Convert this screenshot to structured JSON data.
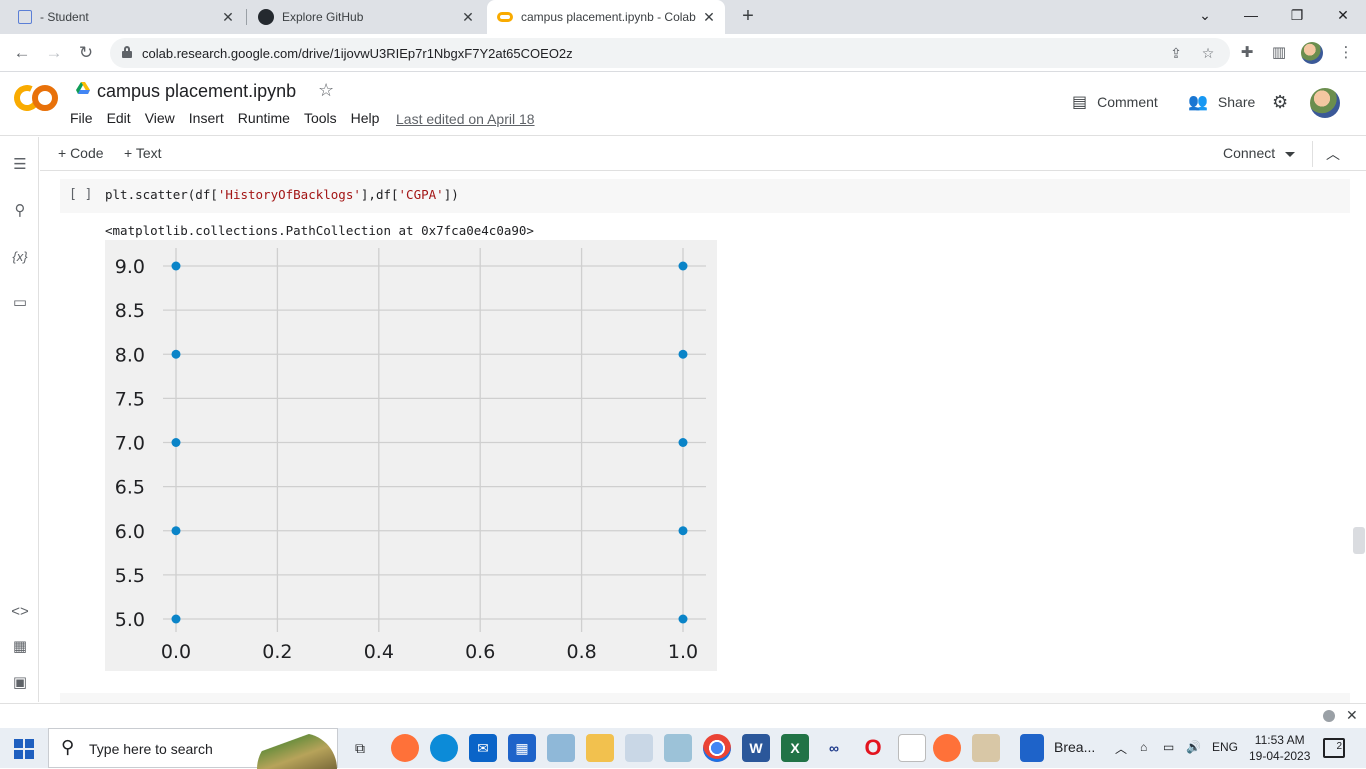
{
  "browser": {
    "tabs": [
      {
        "title": "- Student",
        "icon": "student-favicon"
      },
      {
        "title": "Explore GitHub",
        "icon": "github-favicon"
      },
      {
        "title": "campus placement.ipynb - Colab",
        "icon": "colab-favicon"
      }
    ],
    "new_tab": "+",
    "url": "colab.research.google.com/drive/1ijovwU3RIEp7r1NbgxF7Y2at65COEO2z"
  },
  "colab": {
    "notebook_title": "campus placement.ipynb",
    "menu": [
      "File",
      "Edit",
      "View",
      "Insert",
      "Runtime",
      "Tools",
      "Help"
    ],
    "last_edited": "Last edited on April 18",
    "comment_label": "Comment",
    "share_label": "Share",
    "add_code_label": "+ Code",
    "add_text_label": "+ Text",
    "connect_label": "Connect"
  },
  "cell": {
    "bracket": "[ ]",
    "code_parts": [
      "plt.scatter(df[",
      "'HistoryOfBacklogs'",
      "],df[",
      "'CGPA'",
      "])"
    ],
    "output_text": "<matplotlib.collections.PathCollection at 0x7fca0e4c0a90>"
  },
  "chart_data": {
    "type": "scatter",
    "x": [
      0.0,
      0.0,
      0.0,
      0.0,
      0.0,
      1.0,
      1.0,
      1.0,
      1.0,
      1.0
    ],
    "y": [
      9.0,
      8.0,
      7.0,
      6.0,
      5.0,
      9.0,
      8.0,
      7.0,
      6.0,
      5.0
    ],
    "xlim": [
      -0.14,
      1.05
    ],
    "ylim": [
      4.95,
      9.3
    ],
    "xticks": [
      "0.0",
      "0.2",
      "0.4",
      "0.6",
      "0.8",
      "1.0"
    ],
    "yticks": [
      "5.0",
      "5.5",
      "6.0",
      "6.5",
      "7.0",
      "7.5",
      "8.0",
      "8.5",
      "9.0"
    ],
    "grid": true,
    "point_color": "#0a84c8",
    "background": "#f0f0f0"
  },
  "taskbar": {
    "search_placeholder": "Type here to search",
    "browser_app_label": "Brea...",
    "language": "ENG",
    "time": "11:53 AM",
    "date": "19-04-2023",
    "notification_count": "2"
  }
}
